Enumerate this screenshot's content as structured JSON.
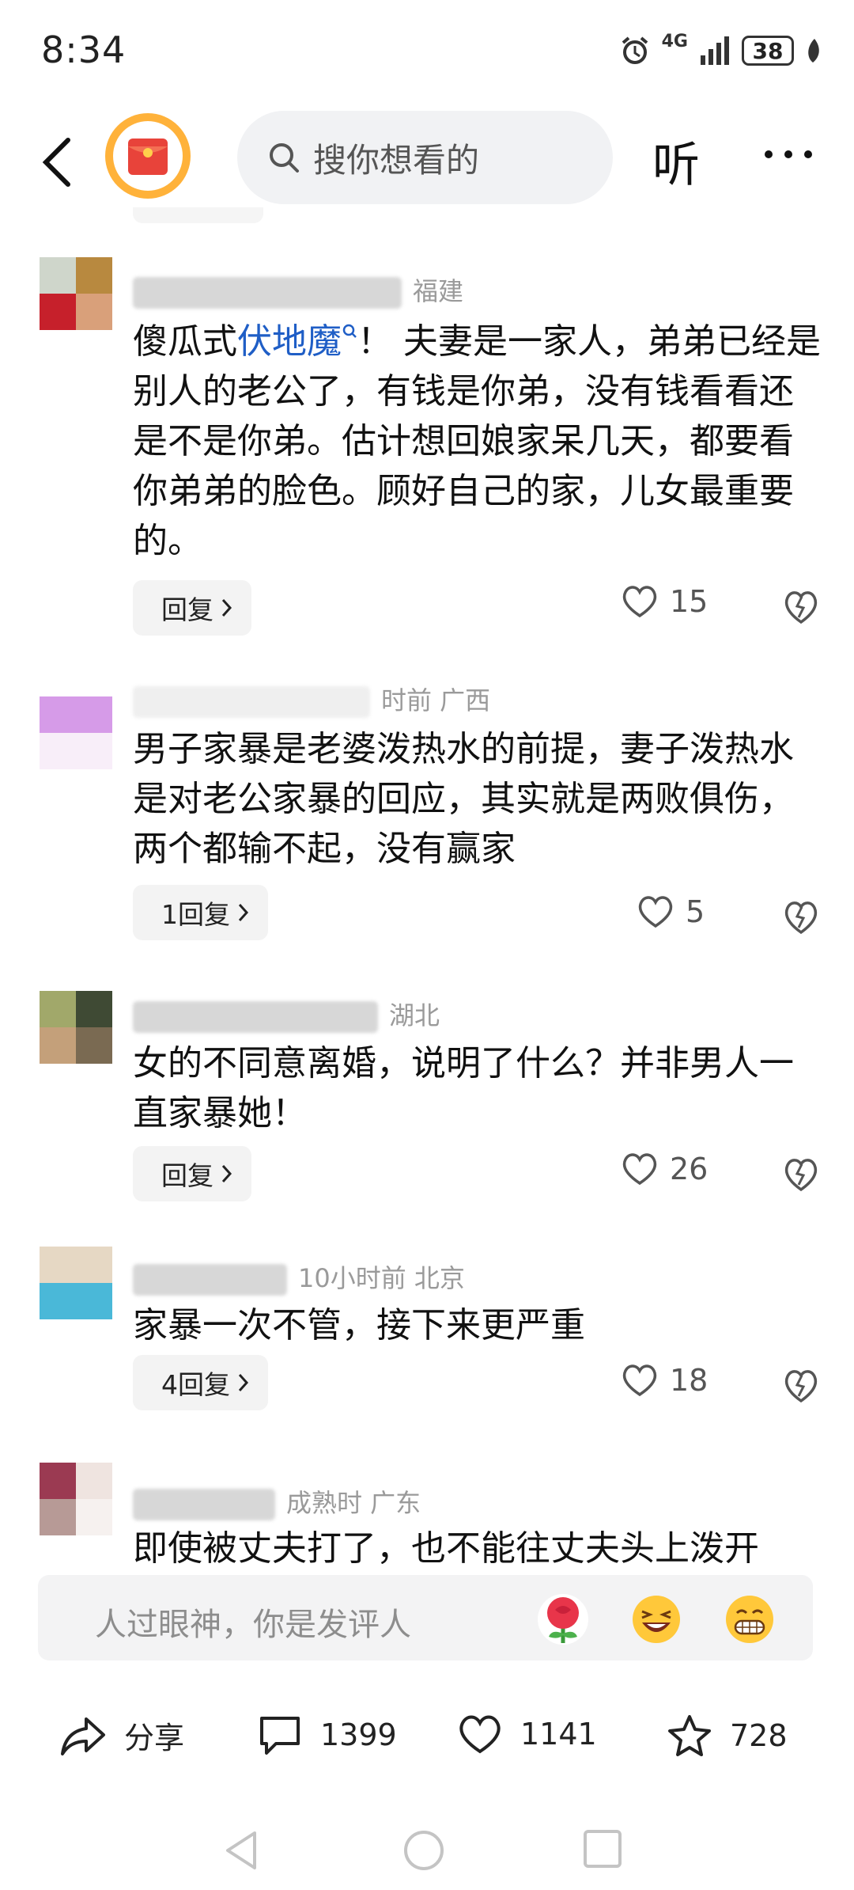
{
  "status": {
    "time": "8:34",
    "network": "4G",
    "battery": "38"
  },
  "header": {
    "search_placeholder": "搜你想看的",
    "listen_label": "听"
  },
  "comments": [
    {
      "meta": "福建",
      "text_pre": "傻瓜式",
      "link": "伏地魔",
      "text_post": "！ 夫妻是一家人，弟弟已经是别人的老公了，有钱是你弟，没有钱看看还是不是你弟。估计想回娘家呆几天，都要看你弟弟的脸色。顾好自己的家，儿女最重要的。",
      "reply": "回复",
      "likes": "15"
    },
    {
      "meta": "时前  广西",
      "text": "男子家暴是老婆泼热水的前提，妻子泼热水是对老公家暴的回应，其实就是两败俱伤，两个都输不起，没有赢家",
      "reply": "1回复",
      "likes": "5"
    },
    {
      "meta": "湖北",
      "text": "女的不同意离婚，说明了什么？并非男人一直家暴她！",
      "reply": "回复",
      "likes": "26"
    },
    {
      "meta": "10小时前  北京",
      "text": "家暴一次不管，接下来更严重",
      "reply": "4回复",
      "likes": "18"
    },
    {
      "meta": "成熟时  广东",
      "text": "即使被丈夫打了，也不能往丈夫头上泼开"
    }
  ],
  "comment_bar": {
    "placeholder": "人过眼神，你是发评人"
  },
  "actions": {
    "share": "分享",
    "comments": "1399",
    "likes": "1141",
    "favorites": "728"
  },
  "icons": [
    "back-icon",
    "red-packet-icon",
    "search-icon",
    "more-icon",
    "heart-icon",
    "dislike-icon",
    "share-icon",
    "comment-icon",
    "star-icon",
    "nav-back-icon",
    "nav-home-icon",
    "nav-recent-icon"
  ]
}
